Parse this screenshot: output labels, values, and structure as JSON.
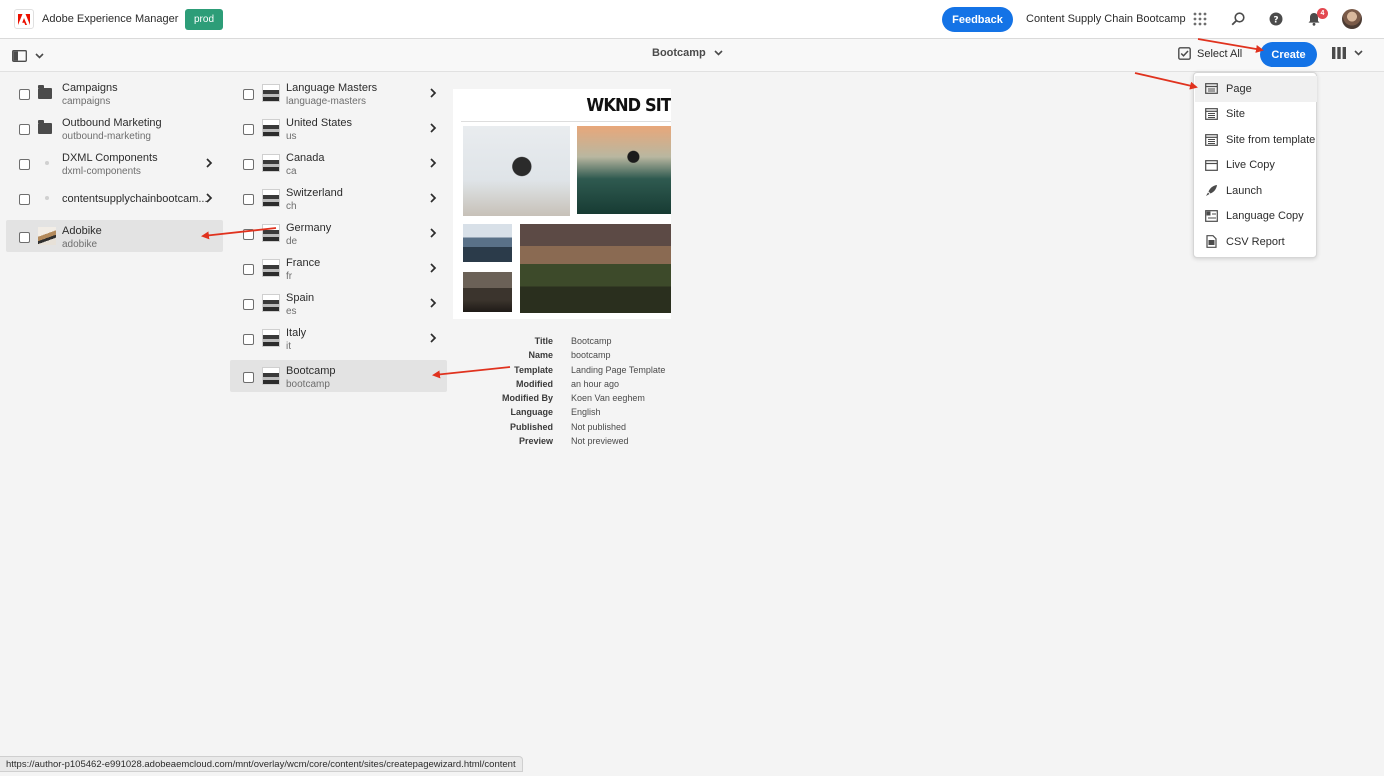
{
  "header": {
    "app_name": "Adobe Experience Manager",
    "env_badge": "prod",
    "feedback_label": "Feedback",
    "org_name": "Content Supply Chain Bootcamp",
    "notification_count": "4",
    "icons": [
      "adobe-logo-icon",
      "apps-grid-icon",
      "search-icon",
      "help-icon",
      "bell-icon",
      "avatar"
    ]
  },
  "actionbar": {
    "title": "Bootcamp",
    "select_all_label": "Select All",
    "create_label": "Create"
  },
  "column1": [
    {
      "title": "Campaigns",
      "name": "campaigns",
      "icon": "folder-icon",
      "has_children": false
    },
    {
      "title": "Outbound Marketing",
      "name": "outbound-marketing",
      "icon": "folder-icon",
      "has_children": false
    },
    {
      "title": "DXML Components",
      "name": "dxml-components",
      "icon": "page-icon",
      "has_children": true
    },
    {
      "title": "contentsupplychainbootcam...",
      "name": "",
      "icon": "page-icon",
      "has_children": true
    },
    {
      "title": "Adobike",
      "name": "adobike",
      "icon": "site-thumbnail",
      "has_children": false,
      "selected": true
    }
  ],
  "column2": [
    {
      "title": "Language Masters",
      "name": "language-masters"
    },
    {
      "title": "United States",
      "name": "us"
    },
    {
      "title": "Canada",
      "name": "ca"
    },
    {
      "title": "Switzerland",
      "name": "ch"
    },
    {
      "title": "Germany",
      "name": "de"
    },
    {
      "title": "France",
      "name": "fr"
    },
    {
      "title": "Spain",
      "name": "es"
    },
    {
      "title": "Italy",
      "name": "it"
    },
    {
      "title": "Bootcamp",
      "name": "bootcamp",
      "selected": true
    }
  ],
  "preview": {
    "heading": "WKND SIT",
    "properties": [
      {
        "label": "Title",
        "value": "Bootcamp"
      },
      {
        "label": "Name",
        "value": "bootcamp"
      },
      {
        "label": "Template",
        "value": "Landing Page Template"
      },
      {
        "label": "Modified",
        "value": "an hour ago"
      },
      {
        "label": "Modified By",
        "value": "Koen Van eeghem"
      },
      {
        "label": "Language",
        "value": "English"
      },
      {
        "label": "Published",
        "value": "Not published"
      },
      {
        "label": "Preview",
        "value": "Not previewed"
      }
    ]
  },
  "create_menu": [
    {
      "label": "Page",
      "icon": "page-icon"
    },
    {
      "label": "Site",
      "icon": "site-icon"
    },
    {
      "label": "Site from template",
      "icon": "site-template-icon"
    },
    {
      "label": "Live Copy",
      "icon": "live-copy-icon"
    },
    {
      "label": "Launch",
      "icon": "launch-icon"
    },
    {
      "label": "Language Copy",
      "icon": "language-copy-icon"
    },
    {
      "label": "CSV Report",
      "icon": "csv-report-icon"
    }
  ],
  "status_url": "https://author-p105462-e991028.adobeaemcloud.com/mnt/overlay/wcm/core/content/sites/createpagewizard.html/content",
  "colors": {
    "accent": "#1473e6",
    "badge": "#2d9d78",
    "annotation": "#e0321e"
  }
}
